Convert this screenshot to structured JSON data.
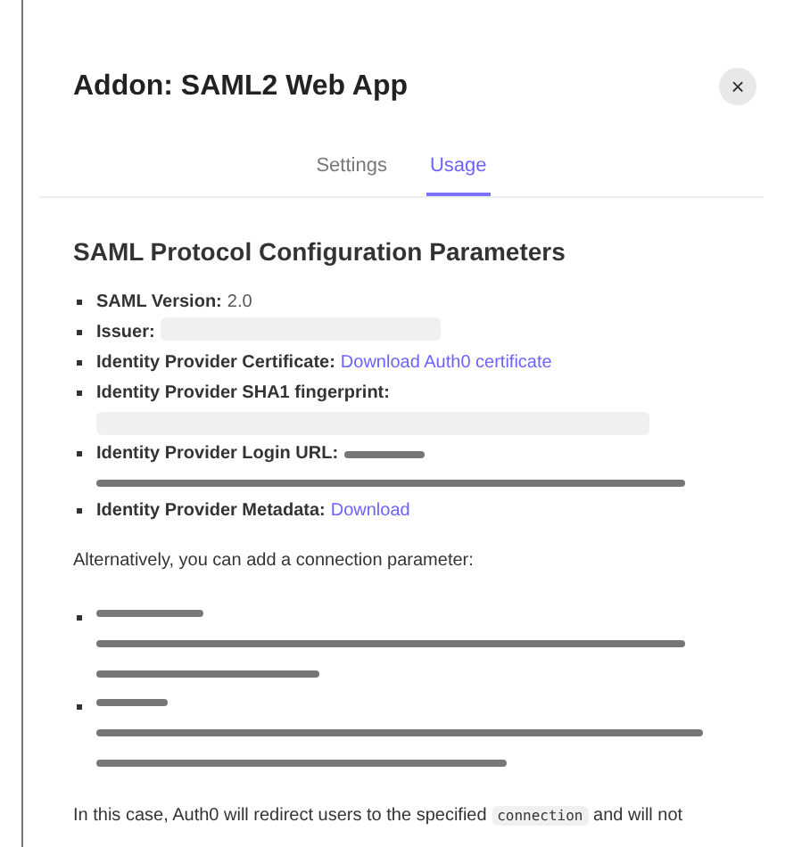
{
  "dialog": {
    "title": "Addon: SAML2 Web App",
    "close_label": "×"
  },
  "tabs": [
    {
      "label": "Settings",
      "selected": false
    },
    {
      "label": "Usage",
      "selected": true
    }
  ],
  "section": {
    "heading": "SAML Protocol Configuration Parameters",
    "parameters": [
      {
        "label": "SAML Version:",
        "kind": "text",
        "value": "2.0"
      },
      {
        "label": "Issuer:",
        "kind": "redacted-code"
      },
      {
        "label": "Identity Provider Certificate:",
        "kind": "link",
        "value": "Download Auth0 certificate"
      },
      {
        "label": "Identity Provider SHA1 fingerprint:",
        "kind": "redacted-code"
      },
      {
        "label": "Identity Provider Login URL:",
        "kind": "redacted-link"
      },
      {
        "label": "Identity Provider Metadata:",
        "kind": "link",
        "value": "Download"
      }
    ],
    "alternative_intro": "Alternatively, you can add a connection parameter:",
    "connection_urls": [
      {
        "kind": "redacted-link"
      },
      {
        "kind": "redacted-link"
      }
    ],
    "note": {
      "before": "In this case, Auth0 will redirect users to the specified",
      "code": "connection",
      "after": "and will not"
    }
  }
}
